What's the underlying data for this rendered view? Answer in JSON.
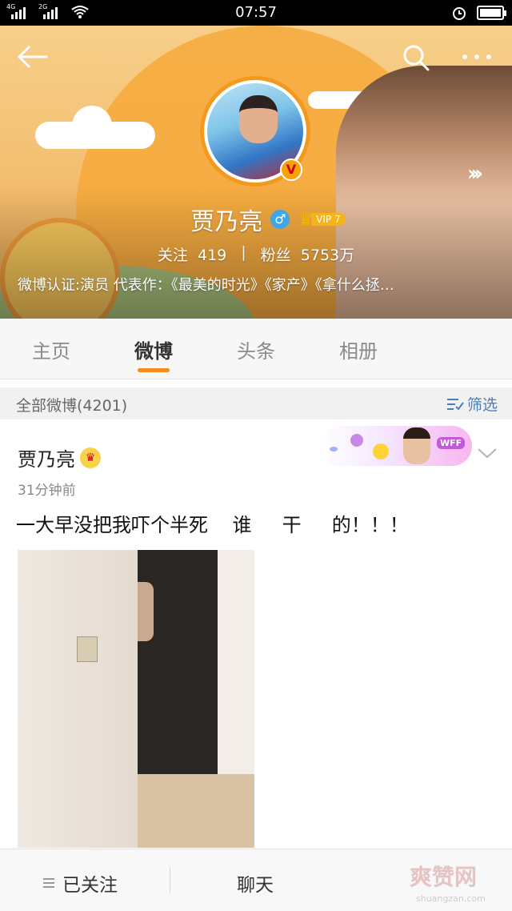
{
  "status_bar": {
    "signal_1": "4G",
    "signal_2": "2G",
    "time": "07:57"
  },
  "profile": {
    "name": "贾乃亮",
    "gender_symbol": "♂",
    "vip_label": "VIP 7",
    "avatar_badge": "V",
    "following_label": "关注",
    "following_count": "419",
    "stats_separator": "|",
    "fans_label": "粉丝",
    "fans_count": "5753万",
    "verification": "微博认证:演员 代表作：《最美的时光》《家产》《拿什么拯…"
  },
  "tabs": [
    {
      "label": "主页",
      "active": false
    },
    {
      "label": "微博",
      "active": true
    },
    {
      "label": "头条",
      "active": false
    },
    {
      "label": "相册",
      "active": false
    }
  ],
  "filter": {
    "count_label": "全部微博(4201)",
    "button_label": "筛选"
  },
  "post": {
    "author": "贾乃亮",
    "time": "31分钟前",
    "text": "一大早没把我吓个半死    谁     干     的！！！",
    "banner_tag": "WFF"
  },
  "bottom_bar": {
    "follow_label": "已关注",
    "chat_label": "聊天"
  },
  "watermark": {
    "logo": "爽赞网",
    "url": "shuangzan.com"
  },
  "colors": {
    "accent_orange": "#f58b1f",
    "link_blue": "#4a7fb5",
    "vip_gold": "#f6b31b"
  }
}
